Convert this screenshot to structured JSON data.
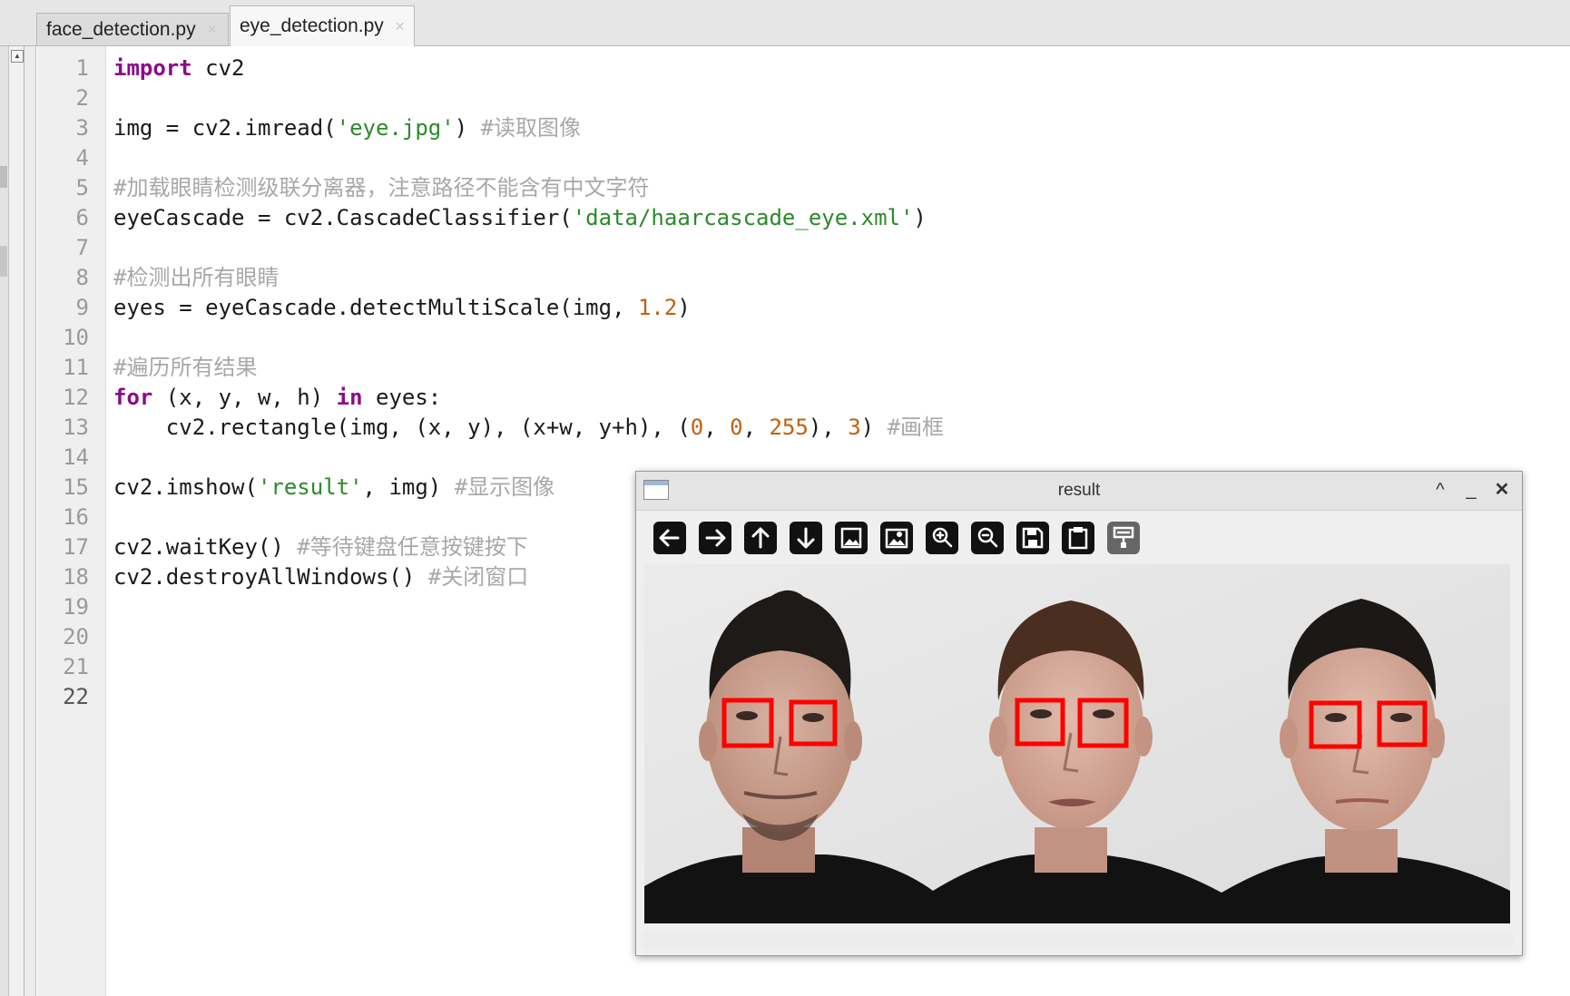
{
  "editor": {
    "tabs": [
      {
        "label": "face_detection.py",
        "active": false
      },
      {
        "label": "eye_detection.py",
        "active": true
      }
    ],
    "line_numbers": [
      "1",
      "2",
      "3",
      "4",
      "5",
      "6",
      "7",
      "8",
      "9",
      "10",
      "11",
      "12",
      "13",
      "14",
      "15",
      "16",
      "17",
      "18",
      "19",
      "20",
      "21",
      "22"
    ],
    "lines": {
      "l1": {
        "kw": "import",
        "rest": " cv2"
      },
      "l3": {
        "a": "img = cv2.imread(",
        "s": "'eye.jpg'",
        "b": ") ",
        "c": "#读取图像"
      },
      "l5": {
        "c": "#加载眼睛检测级联分离器，注意路径不能含有中文字符"
      },
      "l6": {
        "a": "eyeCascade = cv2.CascadeClassifier(",
        "s": "'data/haarcascade_eye.xml'",
        "b": ")"
      },
      "l8": {
        "c": "#检测出所有眼睛"
      },
      "l9": {
        "a": "eyes = eyeCascade.detectMultiScale(img, ",
        "n": "1.2",
        "b": ")"
      },
      "l11": {
        "c": "#遍历所有结果"
      },
      "l12": {
        "kw1": "for",
        "a": " (x, y, w, h) ",
        "kw2": "in",
        "b": " eyes:"
      },
      "l13": {
        "a": "    cv2.rectangle(img, (x, y), (x+w, y+h), (",
        "n1": "0",
        "s1": ", ",
        "n2": "0",
        "s2": ", ",
        "n3": "255",
        "s3": "), ",
        "n4": "3",
        "b": ") ",
        "c": "#画框"
      },
      "l15": {
        "a": "cv2.imshow(",
        "s": "'result'",
        "b": ", img) ",
        "c": "#显示图像"
      },
      "l17": {
        "a": "cv2.waitKey() ",
        "c": "#等待键盘任意按键按下"
      },
      "l18": {
        "a": "cv2.destroyAllWindows() ",
        "c": "#关闭窗口"
      }
    }
  },
  "result_window": {
    "title": "result",
    "controls": {
      "maximize": "^",
      "minimize": "_",
      "close": "✕"
    },
    "toolbar_icons": [
      "arrow-left-icon",
      "arrow-right-icon",
      "arrow-up-icon",
      "arrow-down-icon",
      "image-icon",
      "image-settings-icon",
      "zoom-in-icon",
      "zoom-out-icon",
      "save-icon",
      "clipboard-icon",
      "properties-icon"
    ],
    "detection_box_color": "#ff0000"
  },
  "colors": {
    "keyword": "#8b0a8b",
    "string": "#2a8a2a",
    "number": "#c06010",
    "comment": "#a8a8a8"
  }
}
